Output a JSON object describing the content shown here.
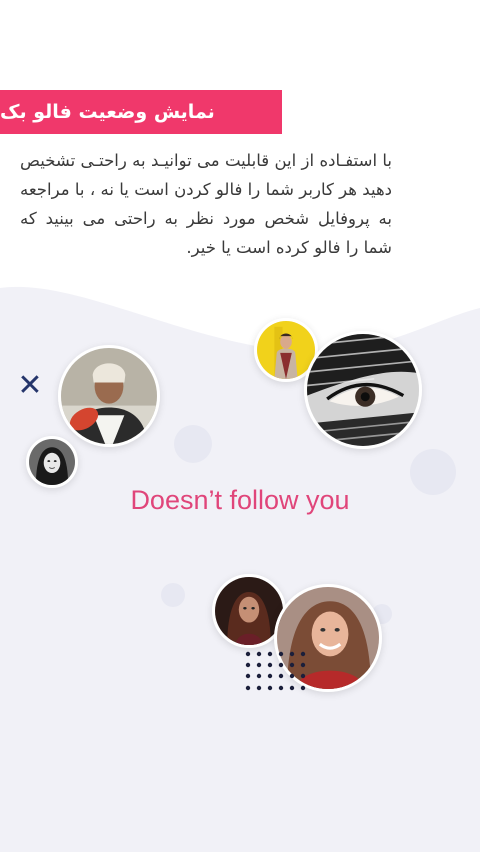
{
  "header": {
    "title": "نمایش وضعیت فالو بک"
  },
  "description": "با استفـاده از این قابلیت می توانیـد به راحتـی تشخیص دهید هر کاربر شما را فالو کردن است یا نه ، با مراجعه به پروفایل شخص مورد نظر به راحتی می بینید که شما را فالو کرده است یا خیر.",
  "status": {
    "label": "Doesn’t follow you",
    "color": "#e0457a"
  },
  "colors": {
    "accent": "#f0386b",
    "close_mark": "#25356b",
    "wave_background": "#f1f1f7"
  },
  "icons": {
    "close": "close-icon"
  },
  "close_symbol": "✕"
}
